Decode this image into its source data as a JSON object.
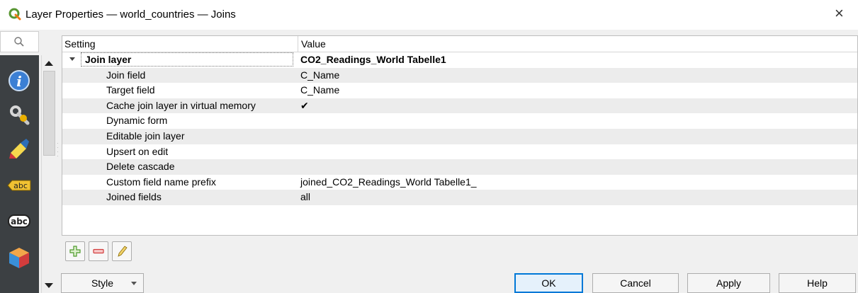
{
  "window": {
    "title": "Layer Properties — world_countries — Joins",
    "close_glyph": "×"
  },
  "sidebar": {
    "icons": [
      "search-icon",
      "information-icon",
      "source-settings-icon",
      "symbology-icon",
      "labels-icon",
      "masks-icon",
      "3d-view-icon"
    ],
    "labels": [
      "abc",
      "abc"
    ]
  },
  "tree": {
    "header": {
      "setting": "Setting",
      "value": "Value"
    },
    "rows": [
      {
        "setting": "Join layer",
        "value": "CO2_Readings_World Tabelle1"
      },
      {
        "setting": "Join field",
        "value": "C_Name"
      },
      {
        "setting": "Target field",
        "value": "C_Name"
      },
      {
        "setting": "Cache join layer in virtual memory",
        "value": "✔"
      },
      {
        "setting": "Dynamic form",
        "value": ""
      },
      {
        "setting": "Editable join layer",
        "value": ""
      },
      {
        "setting": "Upsert on edit",
        "value": ""
      },
      {
        "setting": "Delete cascade",
        "value": ""
      },
      {
        "setting": "Custom field name prefix",
        "value": "joined_CO2_Readings_World Tabelle1_"
      },
      {
        "setting": "Joined fields",
        "value": "all"
      }
    ]
  },
  "toolbar": {
    "icons": [
      "add-join-icon",
      "remove-join-icon",
      "edit-join-icon"
    ]
  },
  "footer": {
    "style_label": "Style",
    "ok_label": "OK",
    "cancel_label": "Cancel",
    "apply_label": "Apply",
    "help_label": "Help"
  },
  "colors": {
    "accent": "#0078d7",
    "sidebar_bg": "#3c4043",
    "qgis_green": "#589632"
  }
}
